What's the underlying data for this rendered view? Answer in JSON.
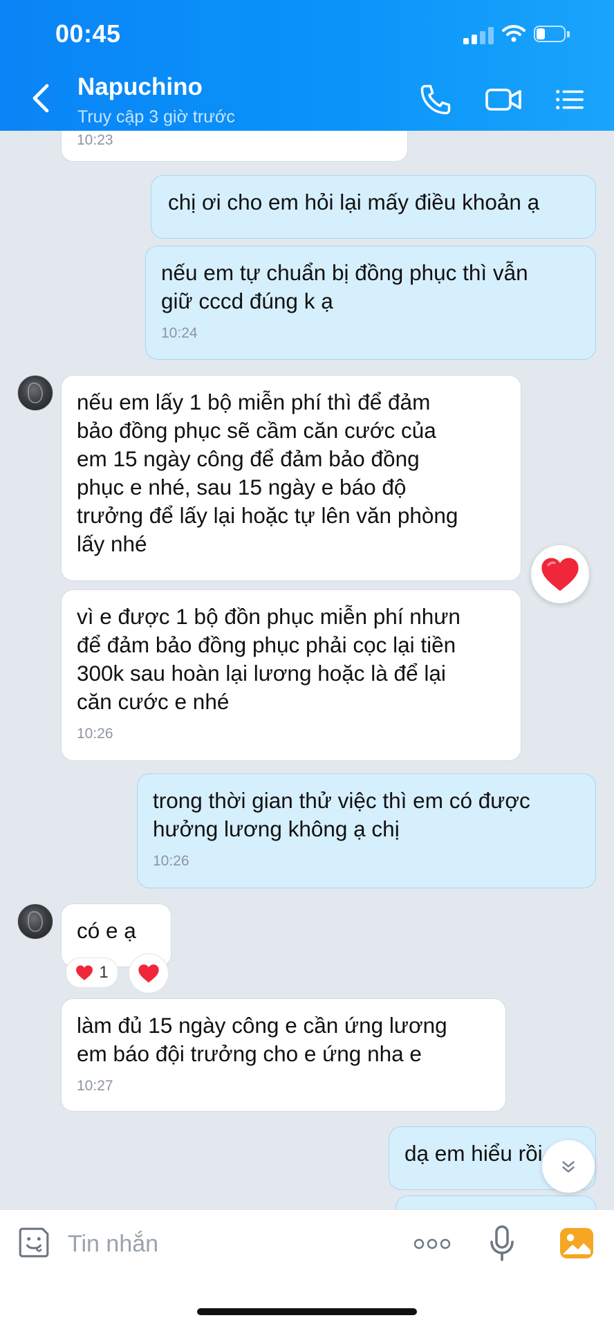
{
  "status_bar": {
    "time": "00:45"
  },
  "header": {
    "contact_name": "Napuchino",
    "last_seen": "Truy cập 3 giờ trước"
  },
  "messages": [
    {
      "side": "in",
      "time": "10:23"
    },
    {
      "side": "out",
      "text": "chị ơi cho em hỏi lại mấy điều khoản ạ"
    },
    {
      "side": "out",
      "text": "nếu em tự chuẩn bị đồng phục thì vẫn\ngiữ cccd đúng k ạ",
      "time": "10:24"
    },
    {
      "side": "in",
      "text": "nếu em lấy 1 bộ miễn phí thì để đảm\nbảo đồng phục sẽ cầm căn cước của\nem 15 ngày công để đảm bảo đồng\nphục e nhé, sau 15 ngày e báo độ\ntrưởng để lấy lại hoặc tự lên văn phòng\nlấy nhé",
      "reaction": "heart"
    },
    {
      "side": "in",
      "text": "vì e được 1 bộ đồn phục miễn phí nhưn\nđể đảm bảo đồng phục phải cọc lại tiền\n300k  sau hoàn lại lương hoặc là để lại\ncăn cước e nhé",
      "time": "10:26"
    },
    {
      "side": "out",
      "text": "trong thời gian thử việc thì em có được\nhưởng lương không ạ chị",
      "time": "10:26"
    },
    {
      "side": "in",
      "text": "có e ạ",
      "reaction_count": "1"
    },
    {
      "side": "in",
      "text": "làm đủ 15 ngày công e cần ứng lương\nem báo đội trưởng cho e ứng nha e",
      "time": "10:27"
    },
    {
      "side": "out",
      "text": "dạ em hiểu rồi"
    }
  ],
  "input": {
    "placeholder": "Tin nhắn"
  },
  "colors": {
    "header": "#0a8ff8",
    "background": "#e3e8ef",
    "incoming_bubble": "#ffffff",
    "outgoing_bubble": "#d6effd",
    "heart": "#f0263a",
    "photo_icon": "#f5a623"
  },
  "icons": [
    "back-icon",
    "phone-icon",
    "video-icon",
    "menu-icon",
    "heart-icon",
    "chevron-down-icon",
    "sticker-icon",
    "more-icon",
    "mic-icon",
    "photo-icon"
  ]
}
